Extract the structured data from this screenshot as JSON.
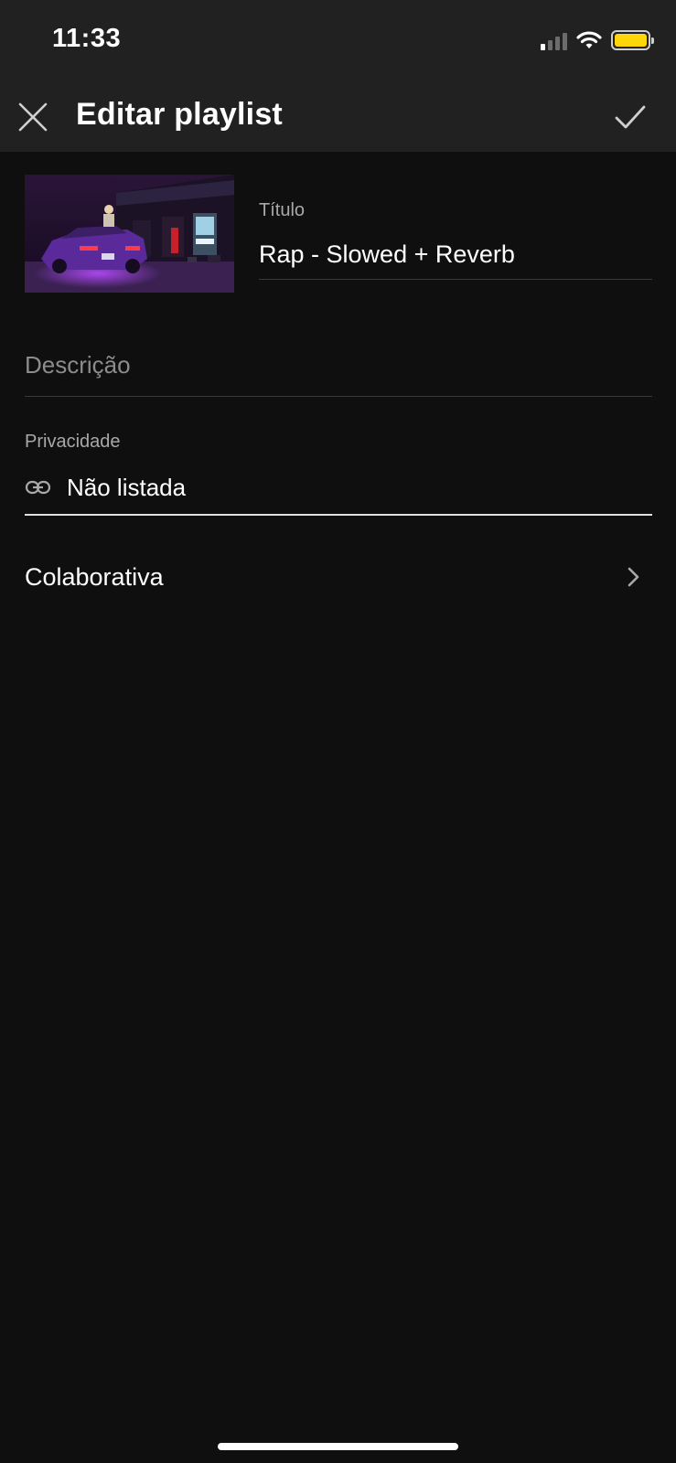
{
  "status_bar": {
    "time": "11:33",
    "icons": [
      "cellular-signal-icon",
      "wifi-icon",
      "battery-icon"
    ],
    "battery_color": "#ffd60a"
  },
  "header": {
    "title": "Editar playlist",
    "close_icon": "close-icon",
    "confirm_icon": "check-icon"
  },
  "form": {
    "title_label": "Título",
    "title_value": "Rap - Slowed + Reverb",
    "description_placeholder": "Descrição",
    "privacy_label": "Privacidade",
    "privacy_value": "Não listada",
    "privacy_icon": "link-icon",
    "collaborative_label": "Colaborativa",
    "collaborative_icon": "chevron-right-icon"
  },
  "colors": {
    "background": "#0f0f0f",
    "header_background": "#212121",
    "muted_text": "#a8a8a8"
  }
}
